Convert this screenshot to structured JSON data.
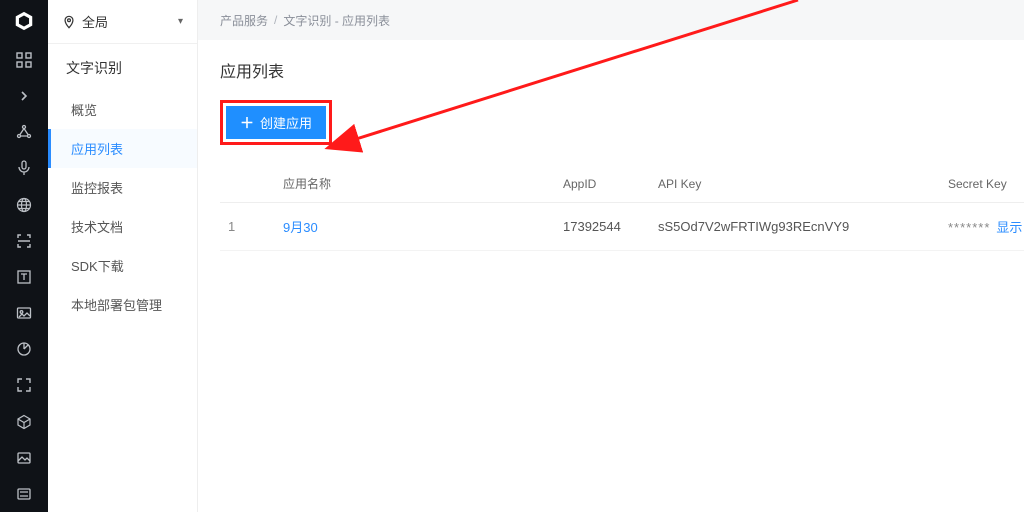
{
  "scope": {
    "label": "全局"
  },
  "section_title": "文字识别",
  "nav": {
    "items": [
      {
        "label": "概览"
      },
      {
        "label": "应用列表"
      },
      {
        "label": "监控报表"
      },
      {
        "label": "技术文档"
      },
      {
        "label": "SDK下载"
      },
      {
        "label": "本地部署包管理"
      }
    ],
    "active_index": 1
  },
  "breadcrumb": {
    "a": "产品服务",
    "b": "文字识别 - 应用列表"
  },
  "panel": {
    "title": "应用列表",
    "create_label": "创建应用"
  },
  "table": {
    "headers": {
      "name": "应用名称",
      "appid": "AppID",
      "apikey": "API Key",
      "secret": "Secret Key"
    },
    "rows": [
      {
        "index": "1",
        "name": "9月30",
        "appid": "17392544",
        "apikey": "sS5Od7V2wFRTIWg93REcnVY9",
        "secret_mask": "*******",
        "show_label": "显示"
      }
    ]
  }
}
